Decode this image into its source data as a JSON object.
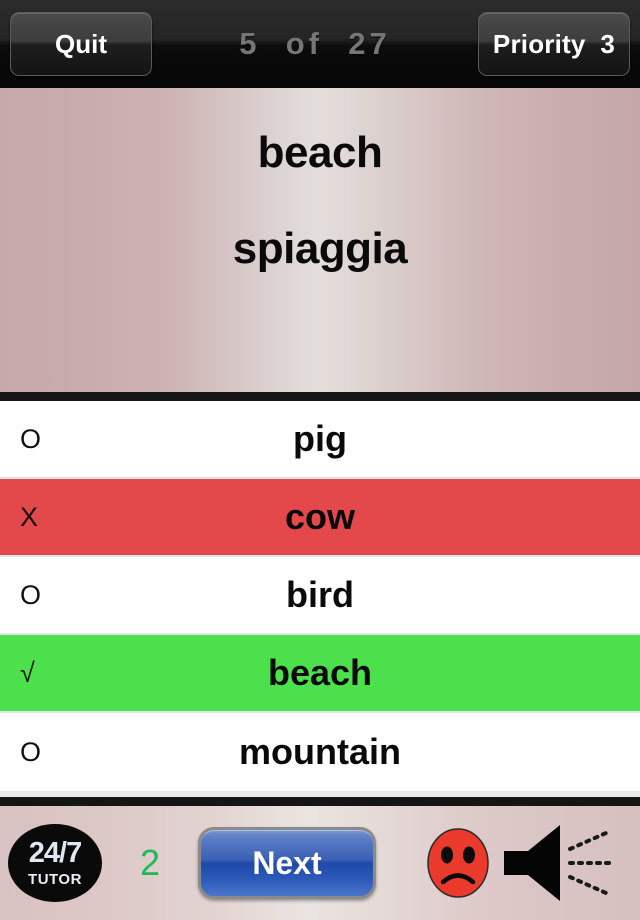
{
  "topbar": {
    "quit_label": "Quit",
    "progress": "5  of  27",
    "priority_label": "Priority  3"
  },
  "card": {
    "term": "beach",
    "translation": "spiaggia",
    "background_left_color": "#c7a9ab",
    "background_center_color": "#e3dedb"
  },
  "options": {
    "items": [
      {
        "marker": "O",
        "label": "pig",
        "state": "neutral",
        "color": "#ffffff"
      },
      {
        "marker": "X",
        "label": "cow",
        "state": "wrong",
        "color": "#e3484b"
      },
      {
        "marker": "O",
        "label": "bird",
        "state": "neutral",
        "color": "#ffffff"
      },
      {
        "marker": "√",
        "label": "beach",
        "state": "correct",
        "color": "#4ce04c"
      },
      {
        "marker": "O",
        "label": "mountain",
        "state": "neutral",
        "color": "#ffffff"
      }
    ]
  },
  "toolbar": {
    "logo_top": "24/7",
    "logo_bottom": "TUTOR",
    "counter": "2",
    "next_label": "Next",
    "sad_face_icon": "sad-face-icon",
    "speaker_icon": "speaker-icon",
    "counter_color": "#22b859",
    "sad_face_color": "#ea3a2b"
  }
}
